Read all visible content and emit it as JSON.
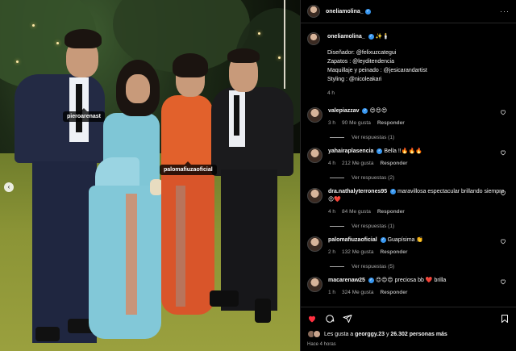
{
  "post": {
    "author": "oneliamolina_",
    "verified": true,
    "caption_emojis": "✨🕯️",
    "caption_lines": [
      "Diseñador: @felixuzcategui",
      "Zapatos : @leyditendencia",
      "Maquillaje y peinado : @jesicarandartist",
      "Styling : @nicoleakari"
    ],
    "caption_time": "4 h",
    "photo_tags": [
      "pieroarenast",
      "palomafiuzaoficial"
    ]
  },
  "comments": [
    {
      "user": "valepiazzav",
      "verified": true,
      "text": "😍😍😍",
      "time": "3 h",
      "likes": "90 Me gusta",
      "reply": "Responder",
      "replies_label": "Ver respuestas (1)"
    },
    {
      "user": "yahairaplasencia",
      "verified": true,
      "text": "Bella !!🔥🔥🔥",
      "time": "4 h",
      "likes": "212 Me gusta",
      "reply": "Responder",
      "replies_label": "Ver respuestas (2)"
    },
    {
      "user": "dra.nathalyterrones95",
      "verified": true,
      "text": "maravillosa espectacular brillando siempre 😍❤️",
      "time": "4 h",
      "likes": "84 Me gusta",
      "reply": "Responder",
      "replies_label": "Ver respuestas (1)"
    },
    {
      "user": "palomafiuzaoficial",
      "verified": true,
      "text": "Guapísima 👏",
      "time": "2 h",
      "likes": "132 Me gusta",
      "reply": "Responder",
      "replies_label": "Ver respuestas (5)"
    },
    {
      "user": "macarenaw25",
      "verified": true,
      "text": "😍😍😍 preciosa bb ❤️ brilla",
      "time": "1 h",
      "likes": "324 Me gusta",
      "reply": "Responder",
      "replies_label": ""
    }
  ],
  "footer": {
    "likes_prefix": "Les gusta a",
    "likes_user": "georggy.23",
    "likes_mid": "y",
    "likes_count": "26.302 personas más",
    "time_ago": "Hace 4 horas"
  },
  "icons": [
    "heart-icon",
    "comment-icon",
    "share-icon",
    "bookmark-icon",
    "more-options-icon",
    "verified-icon",
    "chevron-left-icon"
  ],
  "colors": {
    "accent_like": "#ff3040",
    "verified": "#3897f0",
    "muted": "#a8a8a8"
  }
}
